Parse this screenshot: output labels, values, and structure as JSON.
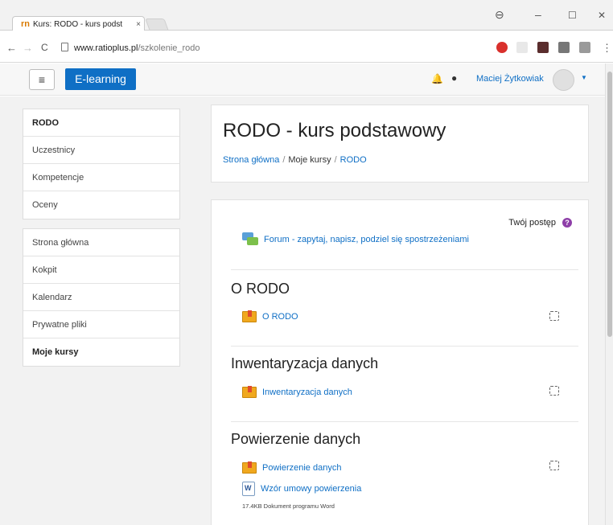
{
  "browser": {
    "tab_title": "Kurs: RODO - kurs podst",
    "tab_icon": "rn",
    "tab_close": "×",
    "url_host": "www.ratioplus.pl",
    "url_path": "/szkolenie_rodo",
    "win_account": "⊖",
    "win_minimize": "–",
    "win_maximize": "☐",
    "win_close": "✕",
    "nav_back": "←",
    "nav_forward": "→",
    "nav_reload": "C",
    "menu": "⋮"
  },
  "navbar": {
    "menu_icon": "≡",
    "brand": "E-learning",
    "user_name": "Maciej Żytkowiak",
    "bell": "🔔",
    "chat": "●",
    "caret": "▼"
  },
  "sidebar": {
    "block1": [
      {
        "label": "RODO",
        "bold": true
      },
      {
        "label": "Uczestnicy"
      },
      {
        "label": "Kompetencje"
      },
      {
        "label": "Oceny"
      }
    ],
    "block2": [
      {
        "label": "Strona główna"
      },
      {
        "label": "Kokpit"
      },
      {
        "label": "Kalendarz"
      },
      {
        "label": "Prywatne pliki"
      },
      {
        "label": "Moje kursy",
        "bold": true
      }
    ]
  },
  "header": {
    "title": "RODO - kurs podstawowy",
    "breadcrumb": [
      "Strona główna",
      "Moje kursy",
      "RODO"
    ],
    "separator": "/"
  },
  "course": {
    "progress_label": "Twój postęp",
    "progress_help": "?",
    "forum": "Forum - zapytaj, napisz, podziel się spostrzeżeniami",
    "sections": [
      {
        "title": "O RODO",
        "activities": [
          "O RODO"
        ]
      },
      {
        "title": "Inwentaryzacja danych",
        "activities": [
          "Inwentaryzacja danych"
        ]
      },
      {
        "title": "Powierzenie danych",
        "activities": [
          "Powierzenie danych",
          "Wzór umowy powierzenia"
        ]
      }
    ],
    "file_meta": "17.4KB Dokument programu Word"
  },
  "colors": {
    "brand": "#0f6fc5",
    "progress_help": "#8e3fa8"
  }
}
